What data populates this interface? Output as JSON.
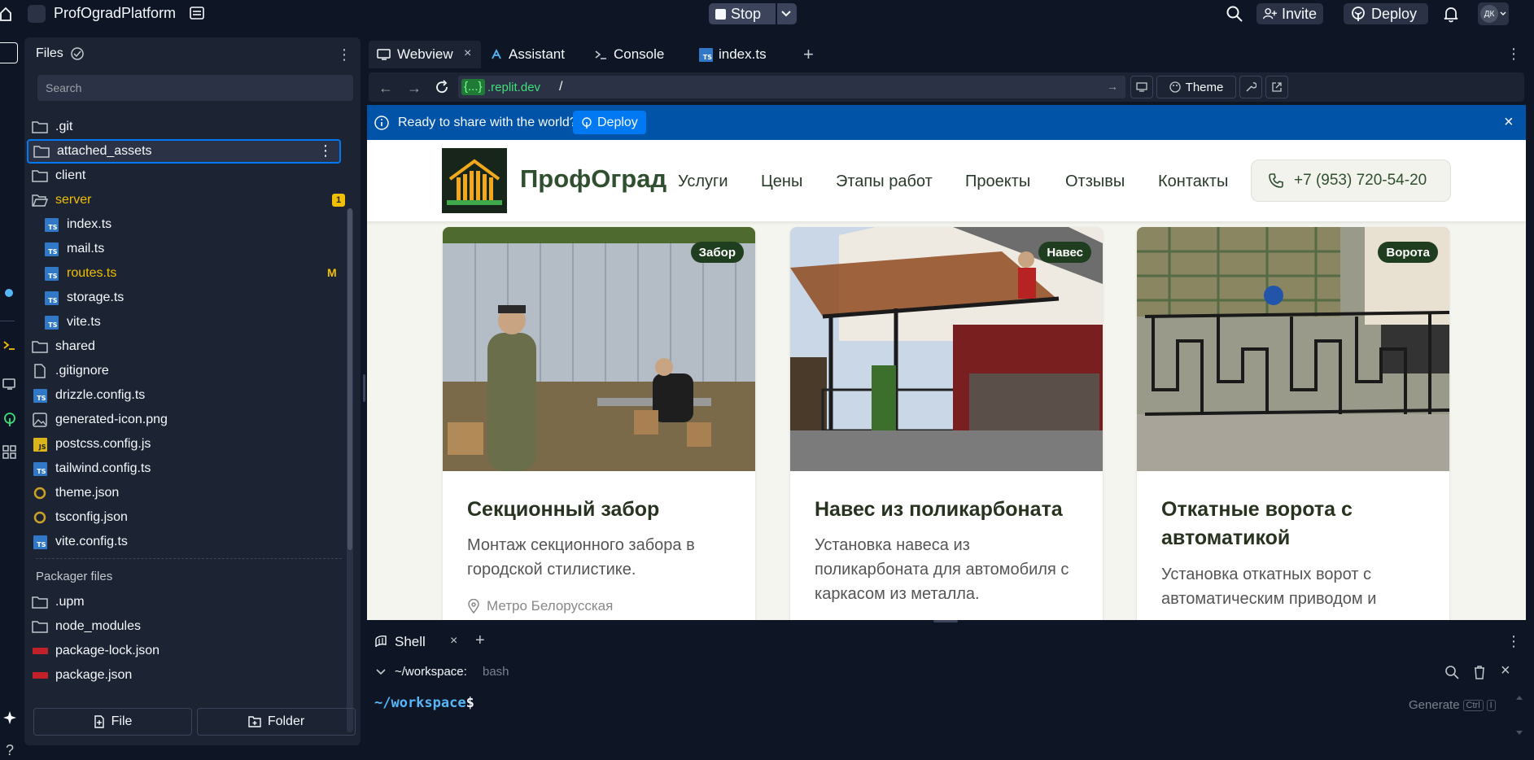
{
  "app": {
    "project_name": "ProfOgradPlatform",
    "stop_label": "Stop",
    "invite_label": "Invite",
    "deploy_label": "Deploy",
    "avatar_initials": "ДК"
  },
  "files_panel": {
    "title": "Files",
    "search_placeholder": "Search",
    "items": [
      {
        "name": ".git",
        "icon": "folder-icon"
      },
      {
        "name": "attached_assets",
        "icon": "folder-icon"
      },
      {
        "name": "client",
        "icon": "folder-icon"
      },
      {
        "name": "server",
        "icon": "folder-open-icon",
        "badge": "1"
      },
      {
        "name": "index.ts",
        "icon": "ts-icon"
      },
      {
        "name": "mail.ts",
        "icon": "ts-icon"
      },
      {
        "name": "routes.ts",
        "icon": "ts-icon",
        "badge": "M"
      },
      {
        "name": "storage.ts",
        "icon": "ts-icon"
      },
      {
        "name": "vite.ts",
        "icon": "ts-icon"
      },
      {
        "name": "shared",
        "icon": "folder-icon"
      },
      {
        "name": ".gitignore",
        "icon": "file-icon"
      },
      {
        "name": "drizzle.config.ts",
        "icon": "ts-icon"
      },
      {
        "name": "generated-icon.png",
        "icon": "image-icon"
      },
      {
        "name": "postcss.config.js",
        "icon": "js-icon"
      },
      {
        "name": "tailwind.config.ts",
        "icon": "ts-icon"
      },
      {
        "name": "theme.json",
        "icon": "json-icon"
      },
      {
        "name": "tsconfig.json",
        "icon": "json-icon"
      },
      {
        "name": "vite.config.ts",
        "icon": "ts-icon"
      }
    ],
    "packager_title": "Packager files",
    "packager_items": [
      {
        "name": ".upm",
        "icon": "folder-icon"
      },
      {
        "name": "node_modules",
        "icon": "folder-icon"
      },
      {
        "name": "package-lock.json",
        "icon": "npm-icon"
      },
      {
        "name": "package.json",
        "icon": "npm-icon"
      }
    ],
    "new_file_label": "File",
    "new_folder_label": "Folder"
  },
  "tabs": [
    {
      "label": "Webview",
      "icon": "monitor-icon"
    },
    {
      "label": "Assistant",
      "icon": "assistant-icon"
    },
    {
      "label": "Console",
      "icon": "terminal-icon"
    },
    {
      "label": "index.ts",
      "icon": "ts-icon"
    }
  ],
  "webview": {
    "url_domain": ".replit.dev",
    "url_prefix": "{...}",
    "url_path": "/",
    "theme_label": "Theme",
    "banner_text": "Ready to share with the world?",
    "banner_button": "Deploy"
  },
  "site": {
    "brand": "ПрофОград",
    "nav": [
      "Услуги",
      "Цены",
      "Этапы работ",
      "Проекты",
      "Отзывы",
      "Контакты"
    ],
    "phone": "+7 (953) 720-54-20",
    "cards": [
      {
        "badge": "Забор",
        "title": "Секционный забор",
        "desc": "Монтаж секционного забора в городской стилистике.",
        "location": "Метро Белорусская"
      },
      {
        "badge": "Навес",
        "title": "Навес из поликарбоната",
        "desc": "Установка навеса из поликарбоната для автомобиля с каркасом из металла."
      },
      {
        "badge": "Ворота",
        "title": "Откатные ворота с автоматикой",
        "desc": "Установка откатных ворот с автоматическим приводом и"
      }
    ]
  },
  "shell": {
    "tab_label": "Shell",
    "path": "~/workspace:",
    "shell_name": "bash",
    "prompt_path": "~/workspace",
    "prompt_symbol": "$",
    "generate_label": "Generate",
    "shortcut_ctrl": "Ctrl",
    "shortcut_key": "I"
  },
  "colors": {
    "bg": "#0e1525",
    "panel": "#1c2333",
    "accent_blue": "#0079f2",
    "banner": "#0053a6",
    "modified": "#f0c000",
    "brand_green": "#2f4f2f"
  }
}
